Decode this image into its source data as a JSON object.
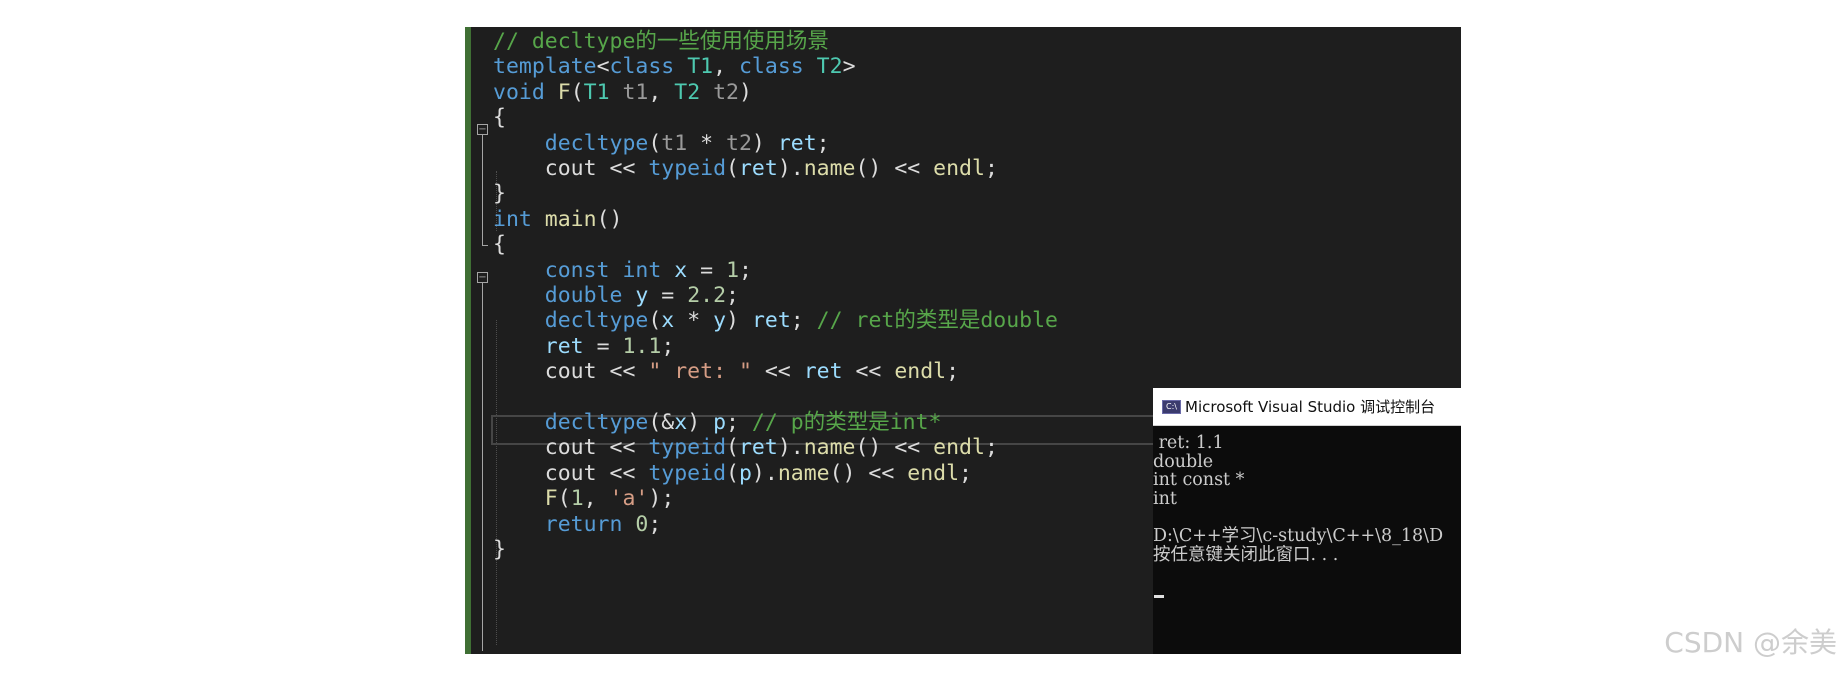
{
  "editor": {
    "lines": [
      [
        {
          "t": "// decltype的一些使用使用场景",
          "c": "comment"
        }
      ],
      [
        {
          "t": "template",
          "c": "kw"
        },
        {
          "t": "<",
          "c": "plain"
        },
        {
          "t": "class",
          "c": "kw"
        },
        {
          "t": " ",
          "c": "plain"
        },
        {
          "t": "T1",
          "c": "type"
        },
        {
          "t": ", ",
          "c": "plain"
        },
        {
          "t": "class",
          "c": "kw"
        },
        {
          "t": " ",
          "c": "plain"
        },
        {
          "t": "T2",
          "c": "type"
        },
        {
          "t": ">",
          "c": "plain"
        }
      ],
      [
        {
          "t": "void",
          "c": "kw"
        },
        {
          "t": " ",
          "c": "plain"
        },
        {
          "t": "F",
          "c": "func"
        },
        {
          "t": "(",
          "c": "plain"
        },
        {
          "t": "T1",
          "c": "type"
        },
        {
          "t": " ",
          "c": "plain"
        },
        {
          "t": "t1",
          "c": "param"
        },
        {
          "t": ", ",
          "c": "plain"
        },
        {
          "t": "T2",
          "c": "type"
        },
        {
          "t": " ",
          "c": "plain"
        },
        {
          "t": "t2",
          "c": "param"
        },
        {
          "t": ")",
          "c": "plain"
        }
      ],
      [
        {
          "t": "{",
          "c": "plain"
        }
      ],
      [
        {
          "t": "    ",
          "c": "plain"
        },
        {
          "t": "decltype",
          "c": "kw"
        },
        {
          "t": "(",
          "c": "plain"
        },
        {
          "t": "t1",
          "c": "param"
        },
        {
          "t": " * ",
          "c": "plain"
        },
        {
          "t": "t2",
          "c": "param"
        },
        {
          "t": ") ",
          "c": "plain"
        },
        {
          "t": "ret",
          "c": "var"
        },
        {
          "t": ";",
          "c": "plain"
        }
      ],
      [
        {
          "t": "    ",
          "c": "plain"
        },
        {
          "t": "cout",
          "c": "plain"
        },
        {
          "t": " << ",
          "c": "plain"
        },
        {
          "t": "typeid",
          "c": "kw"
        },
        {
          "t": "(",
          "c": "plain"
        },
        {
          "t": "ret",
          "c": "var"
        },
        {
          "t": ").",
          "c": "plain"
        },
        {
          "t": "name",
          "c": "func"
        },
        {
          "t": "() << ",
          "c": "plain"
        },
        {
          "t": "endl",
          "c": "func"
        },
        {
          "t": ";",
          "c": "plain"
        }
      ],
      [
        {
          "t": "}",
          "c": "plain"
        }
      ],
      [
        {
          "t": "int",
          "c": "kw"
        },
        {
          "t": " ",
          "c": "plain"
        },
        {
          "t": "main",
          "c": "func"
        },
        {
          "t": "()",
          "c": "plain"
        }
      ],
      [
        {
          "t": "{",
          "c": "plain"
        }
      ],
      [
        {
          "t": "    ",
          "c": "plain"
        },
        {
          "t": "const",
          "c": "kw"
        },
        {
          "t": " ",
          "c": "plain"
        },
        {
          "t": "int",
          "c": "kw"
        },
        {
          "t": " ",
          "c": "plain"
        },
        {
          "t": "x",
          "c": "var"
        },
        {
          "t": " = ",
          "c": "plain"
        },
        {
          "t": "1",
          "c": "num"
        },
        {
          "t": ";",
          "c": "plain"
        }
      ],
      [
        {
          "t": "    ",
          "c": "plain"
        },
        {
          "t": "double",
          "c": "kw"
        },
        {
          "t": " ",
          "c": "plain"
        },
        {
          "t": "y",
          "c": "var"
        },
        {
          "t": " = ",
          "c": "plain"
        },
        {
          "t": "2.2",
          "c": "num"
        },
        {
          "t": ";",
          "c": "plain"
        }
      ],
      [
        {
          "t": "    ",
          "c": "plain"
        },
        {
          "t": "decltype",
          "c": "kw"
        },
        {
          "t": "(",
          "c": "plain"
        },
        {
          "t": "x",
          "c": "var"
        },
        {
          "t": " * ",
          "c": "plain"
        },
        {
          "t": "y",
          "c": "var"
        },
        {
          "t": ") ",
          "c": "plain"
        },
        {
          "t": "ret",
          "c": "var"
        },
        {
          "t": "; ",
          "c": "plain"
        },
        {
          "t": "// ret的类型是double",
          "c": "comment"
        }
      ],
      [
        {
          "t": "    ",
          "c": "plain"
        },
        {
          "t": "ret",
          "c": "var"
        },
        {
          "t": " = ",
          "c": "plain"
        },
        {
          "t": "1.1",
          "c": "num"
        },
        {
          "t": ";",
          "c": "plain"
        }
      ],
      [
        {
          "t": "    ",
          "c": "plain"
        },
        {
          "t": "cout",
          "c": "plain"
        },
        {
          "t": " << ",
          "c": "plain"
        },
        {
          "t": "\" ret: \"",
          "c": "str"
        },
        {
          "t": " << ",
          "c": "plain"
        },
        {
          "t": "ret",
          "c": "var"
        },
        {
          "t": " << ",
          "c": "plain"
        },
        {
          "t": "endl",
          "c": "func"
        },
        {
          "t": ";",
          "c": "plain"
        }
      ],
      [],
      [
        {
          "t": "    ",
          "c": "plain"
        },
        {
          "t": "decltype",
          "c": "kw"
        },
        {
          "t": "(&",
          "c": "plain"
        },
        {
          "t": "x",
          "c": "var"
        },
        {
          "t": ") ",
          "c": "plain"
        },
        {
          "t": "p",
          "c": "var"
        },
        {
          "t": "; ",
          "c": "plain"
        },
        {
          "t": "// p的类型是int*",
          "c": "comment"
        }
      ],
      [
        {
          "t": "    ",
          "c": "plain"
        },
        {
          "t": "cout",
          "c": "plain"
        },
        {
          "t": " << ",
          "c": "plain"
        },
        {
          "t": "typeid",
          "c": "kw"
        },
        {
          "t": "(",
          "c": "plain"
        },
        {
          "t": "ret",
          "c": "var"
        },
        {
          "t": ").",
          "c": "plain"
        },
        {
          "t": "name",
          "c": "func"
        },
        {
          "t": "() << ",
          "c": "plain"
        },
        {
          "t": "endl",
          "c": "func"
        },
        {
          "t": ";",
          "c": "plain"
        }
      ],
      [
        {
          "t": "    ",
          "c": "plain"
        },
        {
          "t": "cout",
          "c": "plain"
        },
        {
          "t": " << ",
          "c": "plain"
        },
        {
          "t": "typeid",
          "c": "kw"
        },
        {
          "t": "(",
          "c": "plain"
        },
        {
          "t": "p",
          "c": "var"
        },
        {
          "t": ").",
          "c": "plain"
        },
        {
          "t": "name",
          "c": "func"
        },
        {
          "t": "() << ",
          "c": "plain"
        },
        {
          "t": "endl",
          "c": "func"
        },
        {
          "t": ";",
          "c": "plain"
        }
      ],
      [
        {
          "t": "    ",
          "c": "plain"
        },
        {
          "t": "F",
          "c": "func"
        },
        {
          "t": "(",
          "c": "plain"
        },
        {
          "t": "1",
          "c": "num"
        },
        {
          "t": ", ",
          "c": "plain"
        },
        {
          "t": "'a'",
          "c": "str"
        },
        {
          "t": ");",
          "c": "plain"
        }
      ],
      [
        {
          "t": "    ",
          "c": "plain"
        },
        {
          "t": "return",
          "c": "kw"
        },
        {
          "t": " ",
          "c": "plain"
        },
        {
          "t": "0",
          "c": "num"
        },
        {
          "t": ";",
          "c": "plain"
        }
      ],
      [
        {
          "t": "}",
          "c": "plain"
        }
      ]
    ],
    "fold_marker": "−",
    "colors": {
      "background": "#1e1e1e",
      "comment": "#57a64a",
      "keyword": "#569cd6",
      "type": "#4ec9b0",
      "function": "#dcdcaa",
      "variable": "#9cdcfe",
      "parameter": "#9a9a9a",
      "number": "#b5cea8",
      "string": "#d69d85",
      "plain": "#dcdcdc"
    }
  },
  "console": {
    "icon": "console-app-icon",
    "icon_text": "C:\\",
    "title": "Microsoft Visual Studio 调试控制台",
    "output": [
      " ret: 1.1",
      "double",
      "int const *",
      "int",
      "",
      "D:\\C++学习\\c-study\\C++\\8_18\\D",
      "按任意键关闭此窗口. . ."
    ],
    "colors": {
      "background": "#0c0c0c",
      "text": "#cccccc",
      "titlebar": "#ffffff"
    }
  },
  "watermark": "CSDN @余美"
}
